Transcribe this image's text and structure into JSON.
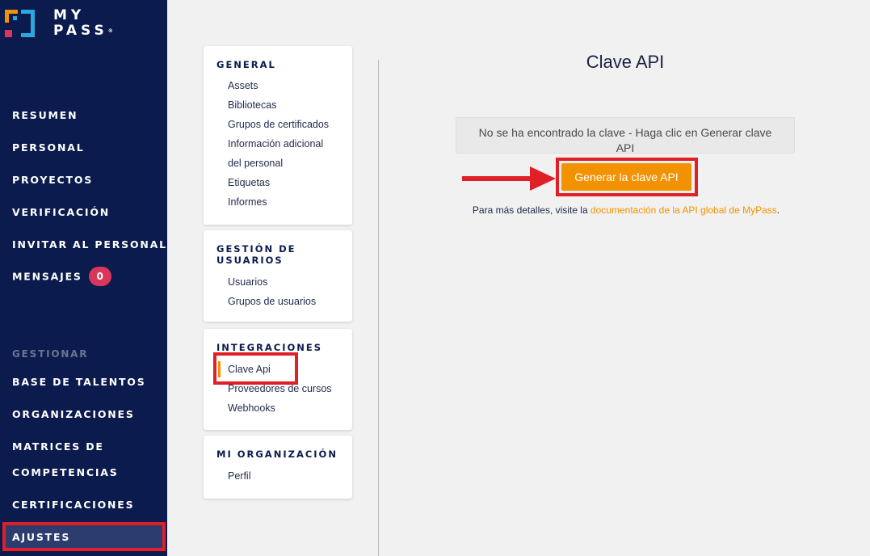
{
  "brand": {
    "line1": "MY",
    "line2": "PASS",
    "reg": "®"
  },
  "sidebar": {
    "items": [
      {
        "label": "RESUMEN"
      },
      {
        "label": "PERSONAL"
      },
      {
        "label": "PROYECTOS"
      },
      {
        "label": "VERIFICACIÓN"
      },
      {
        "label": "INVITAR AL PERSONAL"
      },
      {
        "label": "MENSAJES",
        "badge": "0"
      }
    ],
    "section": "GESTIONAR",
    "manage_items": [
      {
        "label": "BASE DE TALENTOS"
      },
      {
        "label": "ORGANIZACIONES"
      },
      {
        "label": "MATRICES DE"
      },
      {
        "label": "COMPETENCIAS"
      },
      {
        "label": "CERTIFICACIONES"
      },
      {
        "label": "AJUSTES"
      }
    ]
  },
  "settings": {
    "general": {
      "title": "GENERAL",
      "links": [
        "Assets",
        "Bibliotecas",
        "Grupos de certificados",
        "Información adicional",
        "del personal",
        "Etiquetas",
        "Informes"
      ]
    },
    "users": {
      "title_line1": "GESTIÓN DE",
      "title_line2": "USUARIOS",
      "links": [
        "Usuarios",
        "Grupos de usuarios"
      ]
    },
    "integrations": {
      "title": "INTEGRACIONES",
      "links": [
        "Clave Api",
        "Proveedores de cursos",
        "Webhooks"
      ]
    },
    "org": {
      "title": "MI ORGANIZACIÓN",
      "links": [
        "Perfil"
      ]
    }
  },
  "main": {
    "title": "Clave API",
    "alert": "No se ha encontrado la clave - Haga clic en Generar clave API",
    "generate_button": "Generar la clave API",
    "details_prefix": "Para más detalles, visite la ",
    "details_link": "documentación de la API global de MyPass",
    "details_suffix": "."
  },
  "colors": {
    "sidebar": "#0b1b4d",
    "accent": "#f39200",
    "highlight": "#e01f26",
    "badge": "#d8365a"
  }
}
